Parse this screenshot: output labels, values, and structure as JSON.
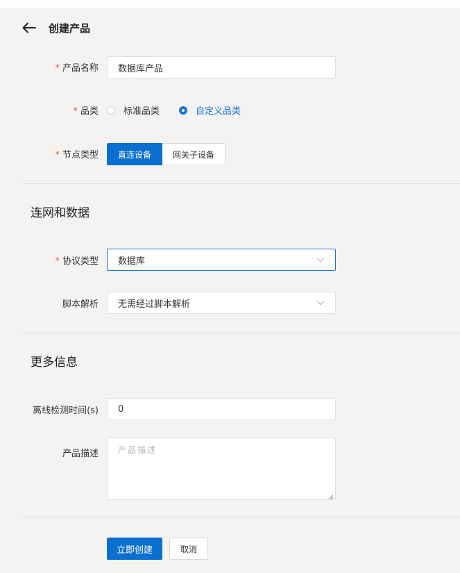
{
  "header": {
    "title": "创建产品",
    "back_icon": "arrow-left-icon"
  },
  "form": {
    "required_mark": "*",
    "product_name": {
      "label": "产品名称",
      "value": "数据库产品"
    },
    "category": {
      "label": "品类",
      "options": [
        "标准品类",
        "自定义品类"
      ],
      "selected": "自定义品类"
    },
    "node_type": {
      "label": "节点类型",
      "options": [
        "直连设备",
        "网关子设备"
      ],
      "selected": "直连设备"
    }
  },
  "network_section": {
    "title": "连网和数据",
    "protocol": {
      "label": "协议类型",
      "value": "数据库"
    },
    "script": {
      "label": "脚本解析",
      "value": "无需经过脚本解析"
    }
  },
  "more_section": {
    "title": "更多信息",
    "offline_check": {
      "label": "离线检测时间(s)",
      "value": "0"
    },
    "description": {
      "label": "产品描述",
      "placeholder": "产品描述"
    }
  },
  "actions": {
    "submit_label": "立即创建",
    "cancel_label": "取消"
  },
  "colors": {
    "primary": "#0b6fd0",
    "required": "#e8573f",
    "background": "#f4f3f2"
  }
}
